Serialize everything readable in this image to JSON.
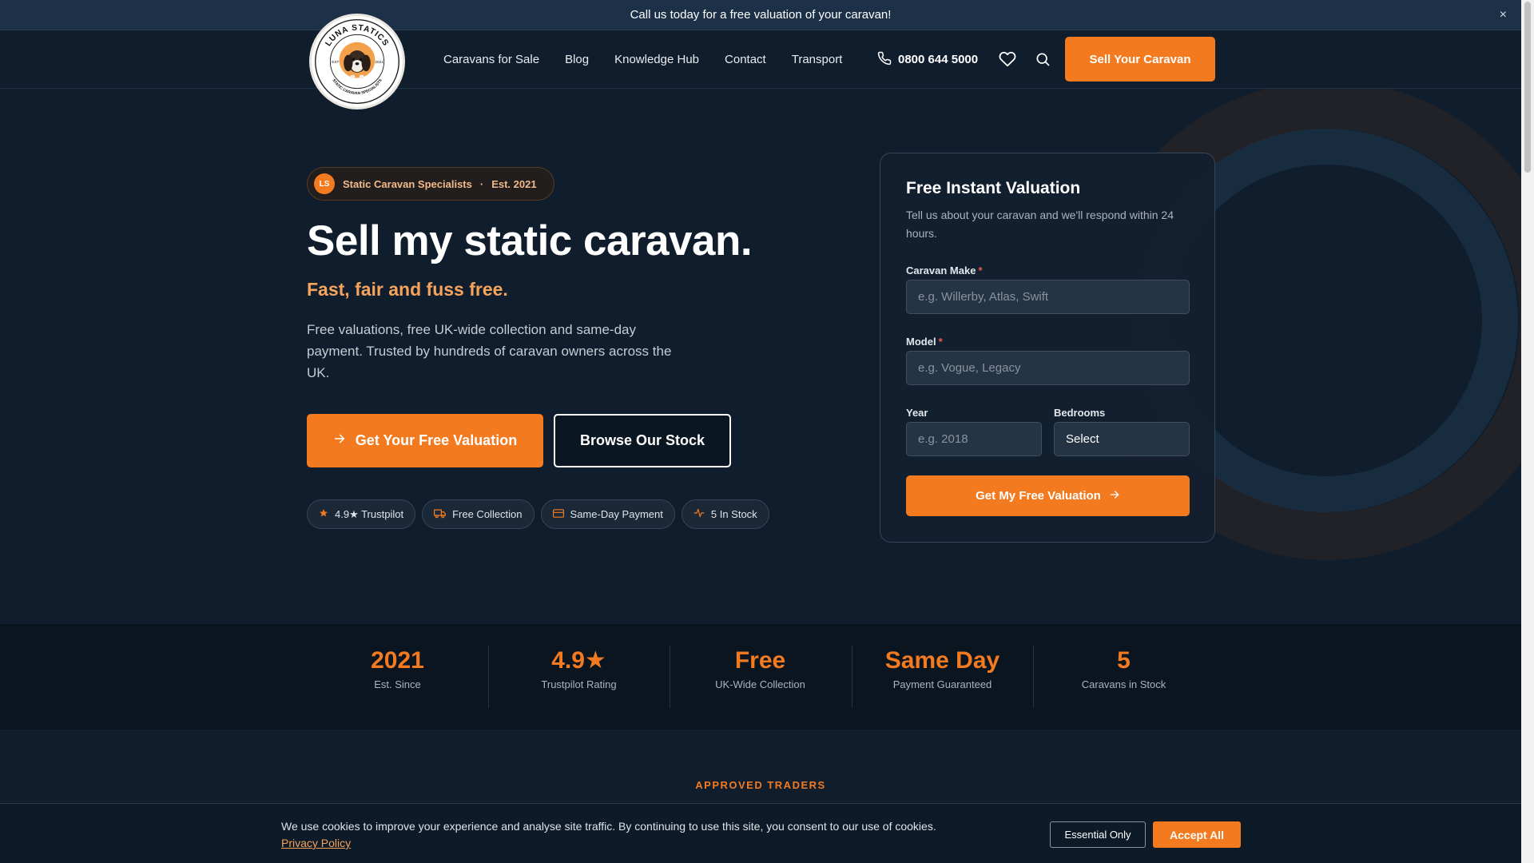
{
  "announcement": {
    "text": "Call us today for a free valuation of your caravan!",
    "close_icon": "×"
  },
  "logo": {
    "top_text": "LUNA STATICS",
    "bottom_text": "STATIC CARAVAN SPECIALISTS",
    "est_label": "EST",
    "year": "2021"
  },
  "nav": {
    "items": [
      "Caravans for Sale",
      "Blog",
      "Knowledge Hub",
      "Contact",
      "Transport"
    ],
    "phone": "0800 644 5000",
    "sell_button": "Sell Your Caravan"
  },
  "hero": {
    "badge_initials": "LS",
    "badge_text": "Static Caravan Specialists",
    "badge_separator": "·",
    "badge_est": "Est. 2021",
    "title": "Sell my static caravan.",
    "subtitle": "Fast, fair and fuss free.",
    "description": "Free valuations, free UK-wide collection and same-day payment. Trusted by hundreds of caravan owners across the UK.",
    "primary_button": "Get Your Free Valuation",
    "secondary_button": "Browse Our Stock",
    "chips": [
      {
        "icon": "star-icon",
        "label": "4.9★ Trustpilot"
      },
      {
        "icon": "truck-icon",
        "label": "Free Collection"
      },
      {
        "icon": "card-icon",
        "label": "Same-Day Payment"
      },
      {
        "icon": "pulse-icon",
        "label": "5 In Stock"
      }
    ]
  },
  "form": {
    "title": "Free Instant Valuation",
    "description": "Tell us about your caravan and we'll respond within 24 hours.",
    "make_label": "Caravan Make",
    "make_placeholder": "e.g. Willerby, Atlas, Swift",
    "model_label": "Model",
    "model_placeholder": "e.g. Vogue, Legacy",
    "year_label": "Year",
    "year_placeholder": "e.g. 2018",
    "bedrooms_label": "Bedrooms",
    "bedrooms_value": "Select",
    "required_marker": "*",
    "submit": "Get My Free Valuation"
  },
  "stats": [
    {
      "value": "2021",
      "label": "Est. Since"
    },
    {
      "value": "4.9★",
      "label": "Trustpilot Rating"
    },
    {
      "value": "Free",
      "label": "UK-Wide Collection"
    },
    {
      "value": "Same Day",
      "label": "Payment Guaranteed"
    },
    {
      "value": "5",
      "label": "Caravans in Stock"
    }
  ],
  "traders": {
    "label": "APPROVED TRADERS"
  },
  "cookie": {
    "text": "We use cookies to improve your experience and analyse site traffic. By continuing to use this site, you consent to our use of cookies.",
    "link": "Privacy Policy",
    "essential_button": "Essential Only",
    "accept_button": "Accept All"
  },
  "colors": {
    "accent": "#f47a1f",
    "background": "#0f1d2c",
    "subtitle": "#f6a45c"
  }
}
